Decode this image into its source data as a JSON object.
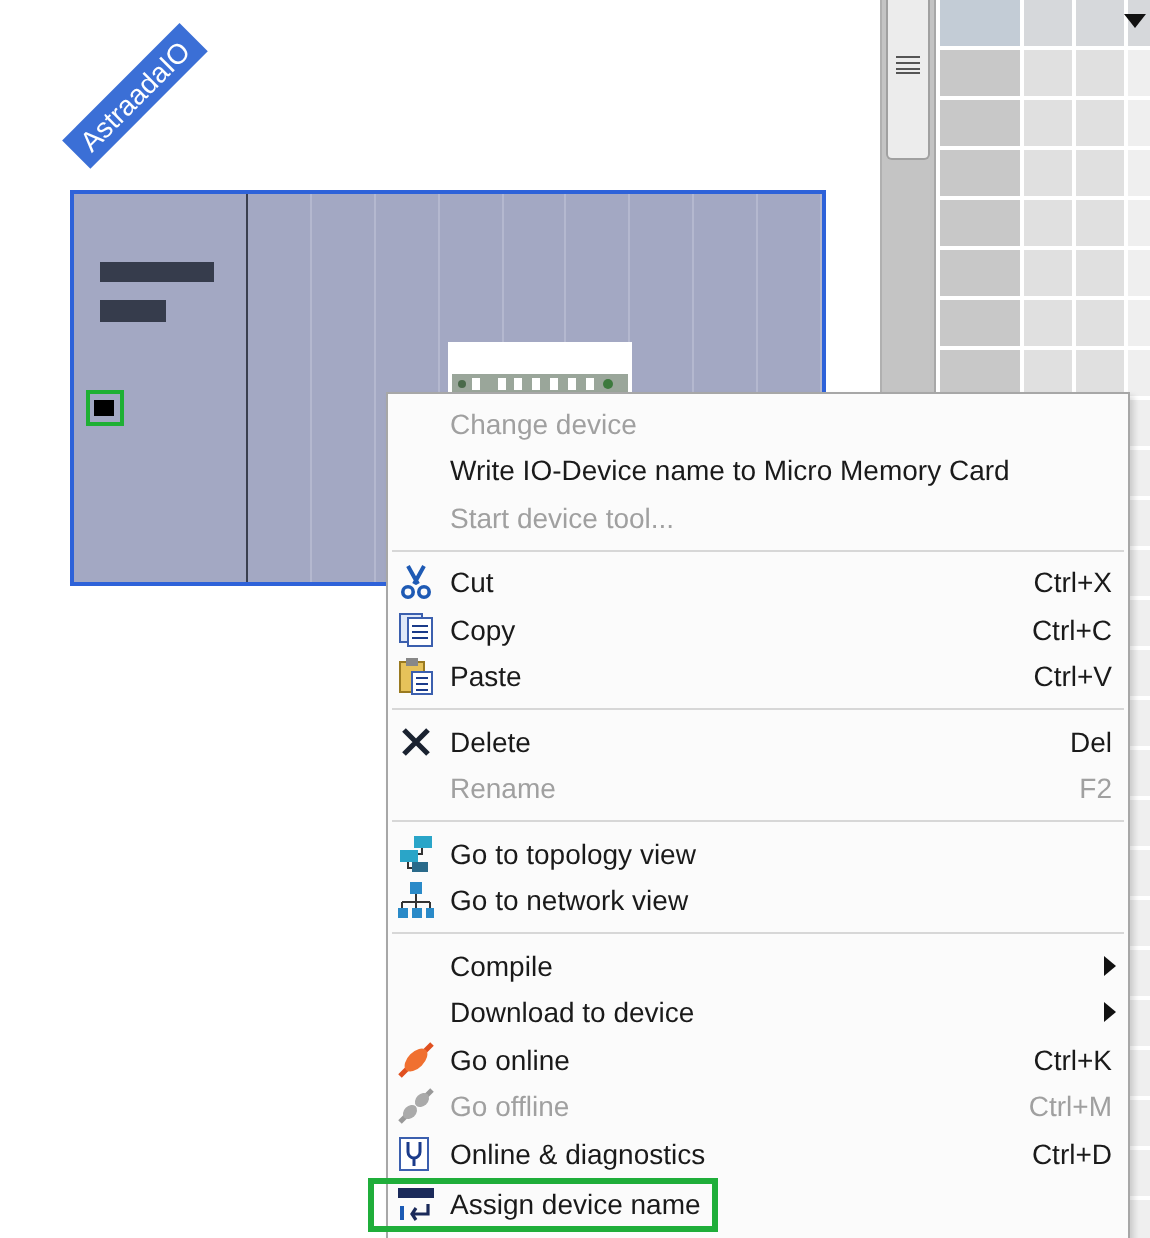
{
  "device": {
    "name": "AstraadaIO"
  },
  "context_menu": {
    "groups": [
      {
        "items": [
          {
            "label": "Change device",
            "disabled": true
          },
          {
            "label": "Write IO-Device name to Micro Memory Card",
            "disabled": false
          },
          {
            "label": "Start device tool...",
            "disabled": true
          }
        ]
      },
      {
        "items": [
          {
            "label": "Cut",
            "shortcut": "Ctrl+X",
            "disabled": false
          },
          {
            "label": "Copy",
            "shortcut": "Ctrl+C",
            "disabled": false
          },
          {
            "label": "Paste",
            "shortcut": "Ctrl+V",
            "disabled": false
          }
        ]
      },
      {
        "items": [
          {
            "label": "Delete",
            "shortcut": "Del",
            "disabled": false
          },
          {
            "label": "Rename",
            "shortcut": "F2",
            "disabled": true
          }
        ]
      },
      {
        "items": [
          {
            "label": "Go to topology view",
            "disabled": false
          },
          {
            "label": "Go to network view",
            "disabled": false
          }
        ]
      },
      {
        "items": [
          {
            "label": "Compile",
            "disabled": false,
            "submenu": true
          },
          {
            "label": "Download to device",
            "disabled": false,
            "submenu": true
          },
          {
            "label": "Go online",
            "shortcut": "Ctrl+K",
            "disabled": false
          },
          {
            "label": "Go offline",
            "shortcut": "Ctrl+M",
            "disabled": true
          },
          {
            "label": "Online & diagnostics",
            "shortcut": "Ctrl+D",
            "disabled": false
          },
          {
            "label": "Assign device name",
            "disabled": false,
            "highlighted": true
          }
        ]
      }
    ]
  }
}
